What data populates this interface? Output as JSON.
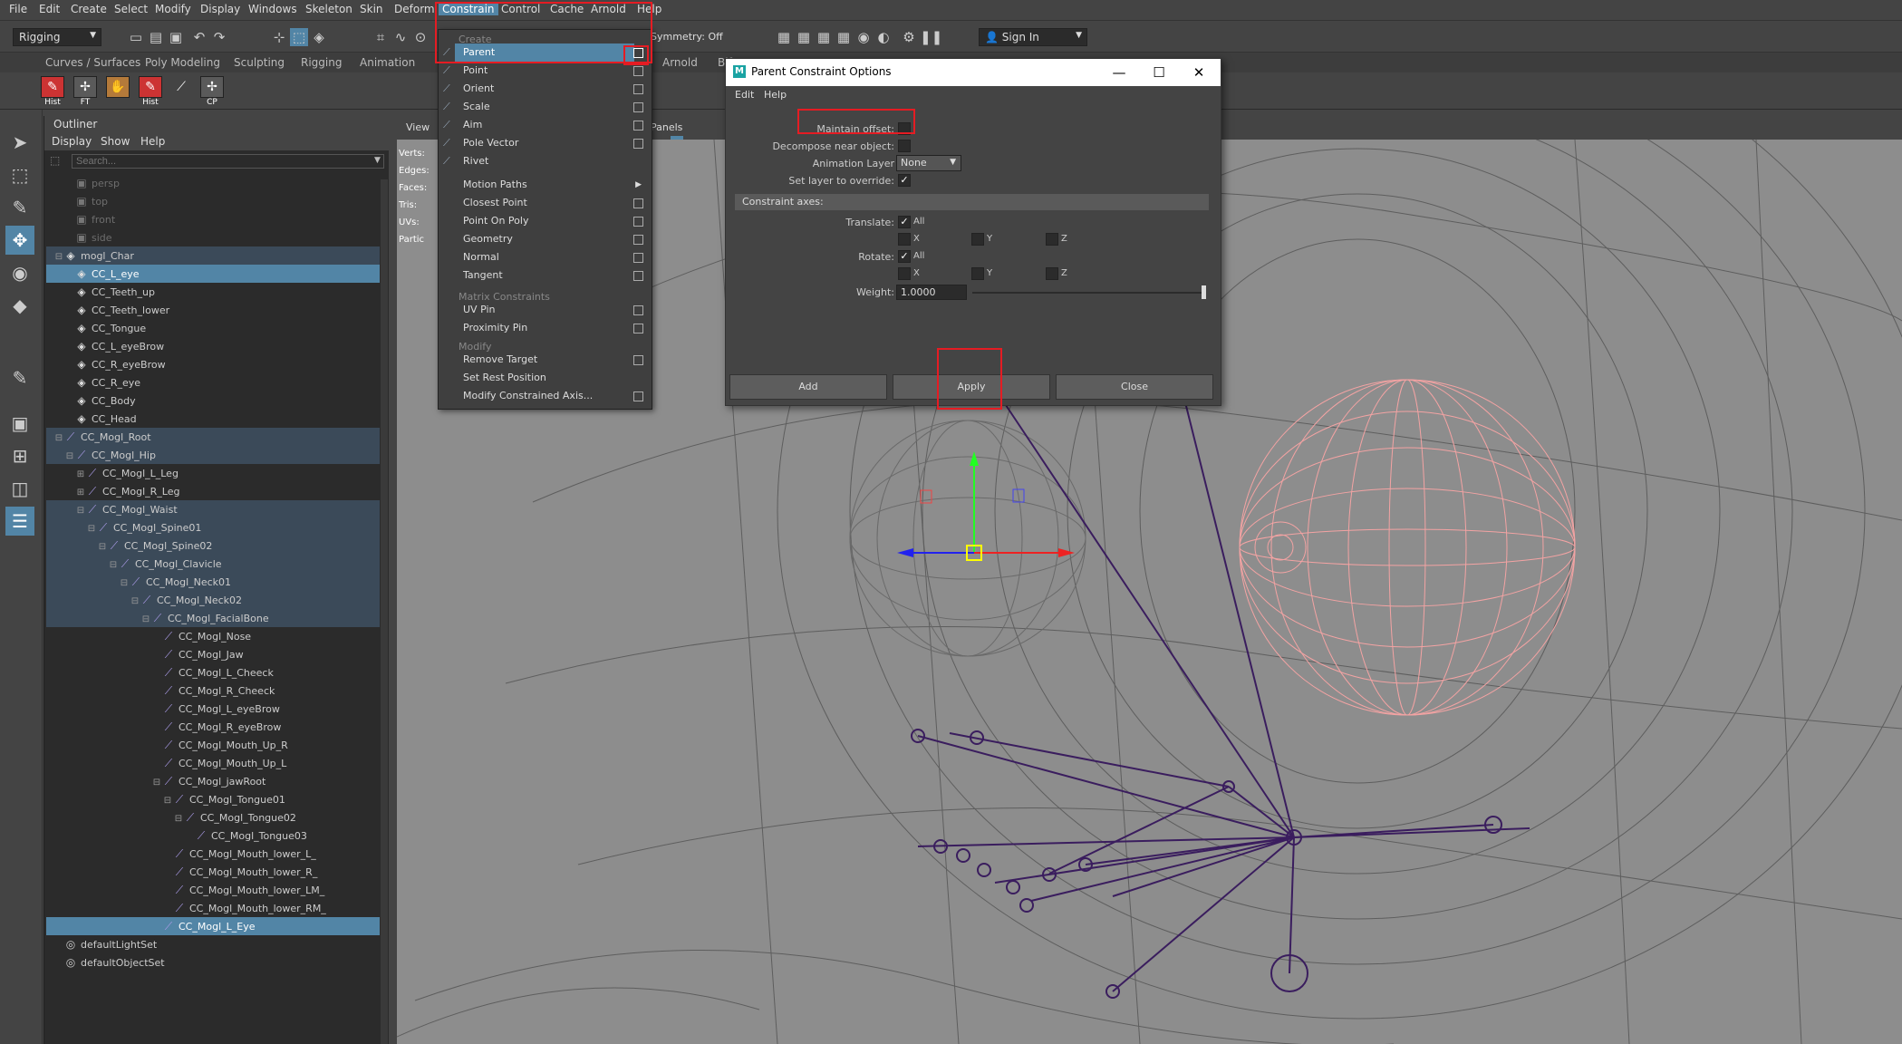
{
  "menubar": {
    "items": [
      "File",
      "Edit",
      "Create",
      "Select",
      "Modify",
      "Display",
      "Windows",
      "Skeleton",
      "Skin",
      "Deform",
      "Constrain",
      "Control",
      "Cache",
      "Arnold",
      "Help"
    ],
    "active": "Constrain"
  },
  "statusline": {
    "mode": "Rigging",
    "symmetry": "Symmetry: Off",
    "sign_in": "Sign In"
  },
  "shelf": {
    "tabs": [
      "Curves / Surfaces",
      "Poly Modeling",
      "Sculpting",
      "Rigging",
      "Animation",
      "Arnold",
      "Bifrost"
    ],
    "icons": [
      {
        "name": "hist-icon",
        "label": "Hist"
      },
      {
        "name": "freeze-transform-icon",
        "label": "FT"
      },
      {
        "name": "hand-icon",
        "label": ""
      },
      {
        "name": "hist-icon",
        "label": "Hist"
      },
      {
        "name": "joint-icon",
        "label": ""
      },
      {
        "name": "center-pivot-icon",
        "label": "CP"
      }
    ]
  },
  "outliner": {
    "title": "Outliner",
    "menus": [
      "Display",
      "Show",
      "Help"
    ],
    "search_placeholder": "Search...",
    "rows": [
      {
        "label": "persp",
        "indent": 1,
        "icon": "camera",
        "state": "dim"
      },
      {
        "label": "top",
        "indent": 1,
        "icon": "camera",
        "state": "dim"
      },
      {
        "label": "front",
        "indent": 1,
        "icon": "camera",
        "state": "dim"
      },
      {
        "label": "side",
        "indent": 1,
        "icon": "camera",
        "state": "dim"
      },
      {
        "label": "mogl_Char",
        "indent": 0,
        "icon": "mesh",
        "exp": "-",
        "state": "hl"
      },
      {
        "label": "CC_L_eye",
        "indent": 1,
        "icon": "mesh",
        "state": "sel"
      },
      {
        "label": "CC_Teeth_up",
        "indent": 1,
        "icon": "mesh",
        "state": ""
      },
      {
        "label": "CC_Teeth_lower",
        "indent": 1,
        "icon": "mesh",
        "state": ""
      },
      {
        "label": "CC_Tongue",
        "indent": 1,
        "icon": "mesh",
        "state": ""
      },
      {
        "label": "CC_L_eyeBrow",
        "indent": 1,
        "icon": "mesh",
        "state": ""
      },
      {
        "label": "CC_R_eyeBrow",
        "indent": 1,
        "icon": "mesh",
        "state": ""
      },
      {
        "label": "CC_R_eye",
        "indent": 1,
        "icon": "mesh",
        "state": ""
      },
      {
        "label": "CC_Body",
        "indent": 1,
        "icon": "mesh",
        "state": ""
      },
      {
        "label": "CC_Head",
        "indent": 1,
        "icon": "mesh",
        "state": ""
      },
      {
        "label": "CC_Mogl_Root",
        "indent": 0,
        "icon": "joint",
        "exp": "-",
        "state": "hl"
      },
      {
        "label": "CC_Mogl_Hip",
        "indent": 1,
        "icon": "joint",
        "exp": "-",
        "state": "hl"
      },
      {
        "label": "CC_Mogl_L_Leg",
        "indent": 2,
        "icon": "joint",
        "exp": "+",
        "state": ""
      },
      {
        "label": "CC_Mogl_R_Leg",
        "indent": 2,
        "icon": "joint",
        "exp": "+",
        "state": ""
      },
      {
        "label": "CC_Mogl_Waist",
        "indent": 2,
        "icon": "joint",
        "exp": "-",
        "state": "hl"
      },
      {
        "label": "CC_Mogl_Spine01",
        "indent": 3,
        "icon": "joint",
        "exp": "-",
        "state": "hl"
      },
      {
        "label": "CC_Mogl_Spine02",
        "indent": 4,
        "icon": "joint",
        "exp": "-",
        "state": "hl"
      },
      {
        "label": "CC_Mogl_Clavicle",
        "indent": 5,
        "icon": "joint",
        "exp": "-",
        "state": "hl"
      },
      {
        "label": "CC_Mogl_Neck01",
        "indent": 6,
        "icon": "joint",
        "exp": "-",
        "state": "hl"
      },
      {
        "label": "CC_Mogl_Neck02",
        "indent": 7,
        "icon": "joint",
        "exp": "-",
        "state": "hl"
      },
      {
        "label": "CC_Mogl_FacialBone",
        "indent": 8,
        "icon": "joint",
        "exp": "-",
        "state": "hl"
      },
      {
        "label": "CC_Mogl_Nose",
        "indent": 9,
        "icon": "joint",
        "state": ""
      },
      {
        "label": "CC_Mogl_Jaw",
        "indent": 9,
        "icon": "joint",
        "state": ""
      },
      {
        "label": "CC_Mogl_L_Cheeck",
        "indent": 9,
        "icon": "joint",
        "state": ""
      },
      {
        "label": "CC_Mogl_R_Cheeck",
        "indent": 9,
        "icon": "joint",
        "state": ""
      },
      {
        "label": "CC_Mogl_L_eyeBrow",
        "indent": 9,
        "icon": "joint",
        "state": ""
      },
      {
        "label": "CC_Mogl_R_eyeBrow",
        "indent": 9,
        "icon": "joint",
        "state": ""
      },
      {
        "label": "CC_Mogl_Mouth_Up_R",
        "indent": 9,
        "icon": "joint",
        "state": ""
      },
      {
        "label": "CC_Mogl_Mouth_Up_L",
        "indent": 9,
        "icon": "joint",
        "state": ""
      },
      {
        "label": "CC_Mogl_jawRoot",
        "indent": 9,
        "icon": "joint",
        "exp": "-",
        "state": ""
      },
      {
        "label": "CC_Mogl_Tongue01",
        "indent": 10,
        "icon": "joint",
        "exp": "-",
        "state": ""
      },
      {
        "label": "CC_Mogl_Tongue02",
        "indent": 11,
        "icon": "joint",
        "exp": "-",
        "state": ""
      },
      {
        "label": "CC_Mogl_Tongue03",
        "indent": 12,
        "icon": "joint",
        "state": ""
      },
      {
        "label": "CC_Mogl_Mouth_lower_L_",
        "indent": 10,
        "icon": "joint",
        "state": ""
      },
      {
        "label": "CC_Mogl_Mouth_lower_R_",
        "indent": 10,
        "icon": "joint",
        "state": ""
      },
      {
        "label": "CC_Mogl_Mouth_lower_LM_",
        "indent": 10,
        "icon": "joint",
        "state": ""
      },
      {
        "label": "CC_Mogl_Mouth_lower_RM_",
        "indent": 10,
        "icon": "joint",
        "state": ""
      },
      {
        "label": "CC_Mogl_L_Eye",
        "indent": 9,
        "icon": "joint",
        "state": "sel"
      },
      {
        "label": "defaultLightSet",
        "indent": 0,
        "icon": "set",
        "state": ""
      },
      {
        "label": "defaultObjectSet",
        "indent": 0,
        "icon": "set",
        "state": ""
      }
    ]
  },
  "viewport": {
    "menu_view": "View",
    "menu_panels": "Panels",
    "hud": [
      "Verts:",
      "Edges:",
      "Faces:",
      "Tris:",
      "UVs:",
      "Partic"
    ]
  },
  "constrain_menu": {
    "section_create": "Create",
    "items_create": [
      {
        "label": "Parent",
        "box": true,
        "selected": true
      },
      {
        "label": "Point",
        "box": true
      },
      {
        "label": "Orient",
        "box": true
      },
      {
        "label": "Scale",
        "box": true
      },
      {
        "label": "Aim",
        "box": true
      },
      {
        "label": "Pole Vector",
        "box": true
      },
      {
        "label": "Rivet",
        "box": false
      }
    ],
    "items_mid": [
      {
        "label": "Motion Paths",
        "arrow": true
      },
      {
        "label": "Closest Point",
        "box": true
      },
      {
        "label": "Point On Poly",
        "box": true
      },
      {
        "label": "Geometry",
        "box": true
      },
      {
        "label": "Normal",
        "box": true
      },
      {
        "label": "Tangent",
        "box": true
      }
    ],
    "section_matrix": "Matrix Constraints",
    "items_matrix": [
      {
        "label": "UV Pin",
        "box": true
      },
      {
        "label": "Proximity Pin",
        "box": true
      }
    ],
    "section_modify": "Modify",
    "items_modify": [
      {
        "label": "Remove Target",
        "box": true
      },
      {
        "label": "Set Rest Position",
        "box": false
      },
      {
        "label": "Modify Constrained Axis...",
        "box": true
      }
    ]
  },
  "dialog": {
    "title": "Parent Constraint Options",
    "menus": [
      "Edit",
      "Help"
    ],
    "maintain_offset_label": "Maintain offset:",
    "maintain_offset": false,
    "decompose_label": "Decompose near object:",
    "anim_layer_label": "Animation Layer",
    "anim_layer_value": "None",
    "set_layer_label": "Set layer to override:",
    "set_layer": true,
    "axes_header": "Constraint axes:",
    "translate_label": "Translate:",
    "rotate_label": "Rotate:",
    "all_label": "All",
    "x_label": "X",
    "y_label": "Y",
    "z_label": "Z",
    "weight_label": "Weight:",
    "weight_value": "1.0000",
    "btn_add": "Add",
    "btn_apply": "Apply",
    "btn_close": "Close"
  },
  "colors": {
    "accent": "#5285a6",
    "highlight_box": "#e51c23",
    "wireframe": "#5c5c5c",
    "eye_wire": "#f3a3a3",
    "joint": "#3a1d5e"
  }
}
